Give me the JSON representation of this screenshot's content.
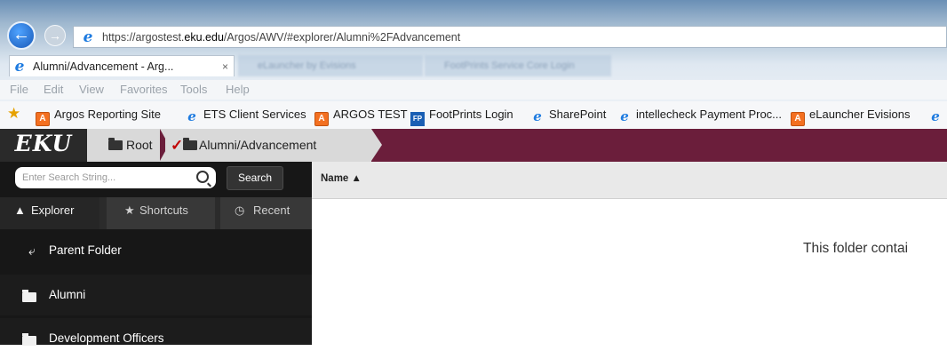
{
  "browser": {
    "url_prefix": "https://argostest.",
    "url_domain": "eku.edu",
    "url_rest": "/Argos/AWV/#explorer/Alumni%2FAdvancement",
    "active_tab_title": "Alumni/Advancement - Arg...",
    "active_tab_close": "×",
    "blurred_tabs": [
      "eLauncher by Evisions",
      "FootPrints Service Core Login"
    ],
    "menu": [
      "File",
      "Edit",
      "View",
      "Favorites",
      "Tools",
      "Help"
    ],
    "favorites": [
      {
        "label": "Argos Reporting Site",
        "icon": "argos-icon"
      },
      {
        "label": "ETS Client Services",
        "icon": "ie-icon"
      },
      {
        "label": "ARGOS TEST",
        "icon": "argos-icon"
      },
      {
        "label": "FootPrints Login",
        "icon": "footprints-icon",
        "icon_text": "FP"
      },
      {
        "label": "SharePoint",
        "icon": "ie-icon"
      },
      {
        "label": "intellecheck Payment Proc...",
        "icon": "ie-icon"
      },
      {
        "label": "eLauncher Evisions",
        "icon": "argos-icon"
      }
    ]
  },
  "app": {
    "logo": "EKU",
    "breadcrumb": {
      "root": "Root",
      "current": "Alumni/Advancement"
    },
    "colors": {
      "header": "#6b1e3b",
      "sidebar": "#171717",
      "accent_check": "#c00000"
    }
  },
  "sidebar": {
    "search_placeholder": "Enter Search String...",
    "search_button": "Search",
    "tabs": [
      {
        "label": "Explorer",
        "icon": "computer-icon"
      },
      {
        "label": "Shortcuts",
        "icon": "star-icon"
      },
      {
        "label": "Recent",
        "icon": "clock-icon"
      }
    ],
    "parent_folder": "Parent Folder",
    "folders": [
      "Alumni",
      "Development Officers"
    ]
  },
  "main": {
    "column_name": "Name",
    "sort_indicator": "▲",
    "message": "This folder contai"
  }
}
